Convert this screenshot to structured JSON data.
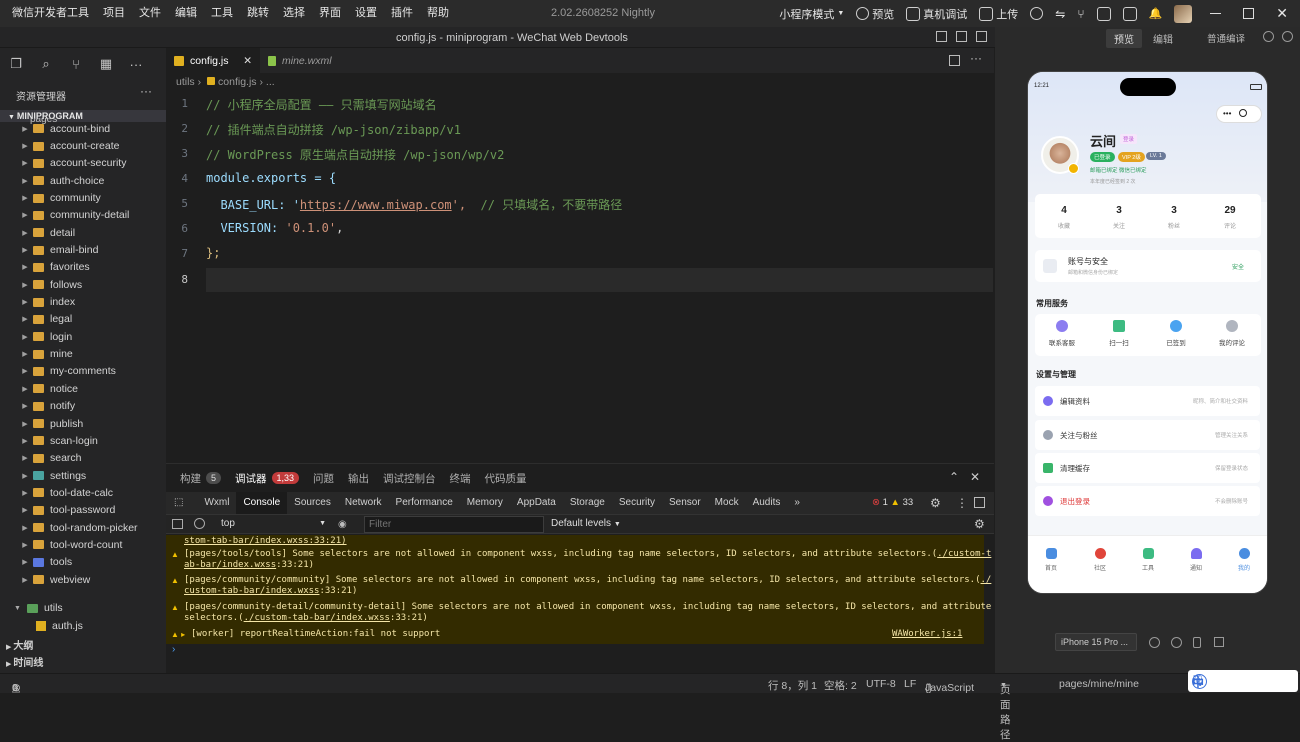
{
  "menu": [
    "微信开发者工具",
    "项目",
    "文件",
    "编辑",
    "工具",
    "跳转",
    "选择",
    "界面",
    "设置",
    "插件",
    "帮助"
  ],
  "version": "2.02.2608252 Nightly",
  "toolbar": {
    "mode": "小程序模式",
    "preview": "预览",
    "realdebug": "真机调试",
    "upload": "上传"
  },
  "window_title": "config.js - miniprogram - WeChat Web Devtools",
  "sim_tabs": {
    "preview": "预览",
    "edit": "编辑",
    "compile": "普通编译"
  },
  "explorer": {
    "title": "资源管理器",
    "project": "MINIPROGRAM",
    "pages_label": "pages",
    "folders": [
      "account-bind",
      "account-create",
      "account-security",
      "auth-choice",
      "community",
      "community-detail",
      "detail",
      "email-bind",
      "favorites",
      "follows",
      "index",
      "legal",
      "login",
      "mine",
      "my-comments",
      "notice",
      "notify",
      "publish",
      "scan-login",
      "search",
      "settings",
      "tool-date-calc",
      "tool-password",
      "tool-random-picker",
      "tool-word-count",
      "tools",
      "webview"
    ],
    "utils": "utils",
    "authjs": "auth.js",
    "outline": "大纲",
    "timeline": "时间线"
  },
  "tabs": {
    "active": "config.js",
    "inactive": "mine.wxml"
  },
  "breadcrumb": {
    "a": "utils",
    "b": "config.js",
    "c": "..."
  },
  "code": {
    "l1": "// 小程序全局配置 —— 只需填写网站域名",
    "l2": "// 插件端点自动拼接 /wp-json/zibapp/v1",
    "l3": "// WordPress 原生端点自动拼接 /wp-json/wp/v2",
    "l4": "module.exports = {",
    "l5a": "  BASE_URL: '",
    "l5b": "https://www.miwap.com",
    "l5c": "',  ",
    "l5d": "// 只填域名，不要带路径",
    "l6a": "  VERSION: ",
    "l6b": "'0.1.0'",
    "l6c": ",",
    "l7": "};"
  },
  "line_numbers": [
    "1",
    "2",
    "3",
    "4",
    "5",
    "6",
    "7",
    "8"
  ],
  "panel": {
    "tabs": [
      "构建",
      "调试器",
      "问题",
      "输出",
      "调试控制台",
      "终端",
      "代码质量"
    ],
    "build_count": "5",
    "debug_count": "1,33",
    "devtools": [
      "Wxml",
      "Console",
      "Sources",
      "Network",
      "Performance",
      "Memory",
      "AppData",
      "Storage",
      "Security",
      "Sensor",
      "Mock",
      "Audits"
    ],
    "err": "1",
    "warn": "33",
    "context": "top",
    "filter": "Filter",
    "levels": "Default levels"
  },
  "logs": {
    "l0": "stom-tab-bar/index.wxss:33:21)",
    "l1a": "[pages/tools/tools] Some selectors are not allowed in component wxss, including tag name selectors, ID selectors, and attribute selectors.(",
    "l1b": "./custom-t",
    "l1c": "ab-bar/index.wxss",
    "l1d": ":33:21)",
    "l2a": "[pages/community/community] Some selectors are not allowed in component wxss, including tag name selectors, ID selectors, and attribute selectors.(",
    "l2b": "./",
    "l2c": "custom-tab-bar/index.wxss",
    "l2d": ":33:21)",
    "l3a": "[pages/community-detail/community-detail] Some selectors are not allowed in component wxss, including tag name selectors, ID selectors, and attribute",
    "l3b": "selectors.(",
    "l3c": "./custom-tab-bar/index.wxss",
    "l3d": ":33:21)",
    "l4": "[worker] reportRealtimeAction:fail not support",
    "l4src": "WAWorker.js:1"
  },
  "status": {
    "errors": "0",
    "warnings": "0",
    "pos": "行 8，列 1",
    "spaces": "空格: 2",
    "enc": "UTF-8",
    "eol": "LF",
    "lang": "JavaScript",
    "pagepath_label": "页面路径",
    "pagepath": "pages/mine/mine"
  },
  "device": "iPhone 15 Pro ...",
  "phone": {
    "time": "12:21",
    "name": "云间",
    "tag": "登录",
    "badges": [
      "已登录",
      "VIP 2级",
      "LV. 1"
    ],
    "sub": "邮箱已绑定  微信已绑定",
    "sub2": "本年度已经签到 2 次",
    "stats": [
      {
        "n": "4",
        "l": "收藏"
      },
      {
        "n": "3",
        "l": "关注"
      },
      {
        "n": "3",
        "l": "粉丝"
      },
      {
        "n": "29",
        "l": "评论"
      }
    ],
    "security": {
      "title": "账号与安全",
      "sub": "邮箱和微信身份已绑定",
      "status": "安全"
    },
    "common": "常用服务",
    "services": [
      "联系客服",
      "扫一扫",
      "已签到",
      "我的评论"
    ],
    "settings": "设置与管理",
    "rows": [
      {
        "t": "编辑资料",
        "s": "昵称、简介和社交资料"
      },
      {
        "t": "关注与粉丝",
        "s": "管理关注关系"
      },
      {
        "t": "清理缓存",
        "s": "保留登录状态"
      },
      {
        "t": "退出登录",
        "s": "不会删除账号"
      }
    ],
    "nav": [
      "首页",
      "社区",
      "工具",
      "通知",
      "我的"
    ]
  },
  "ime": {
    "lang": "中"
  }
}
